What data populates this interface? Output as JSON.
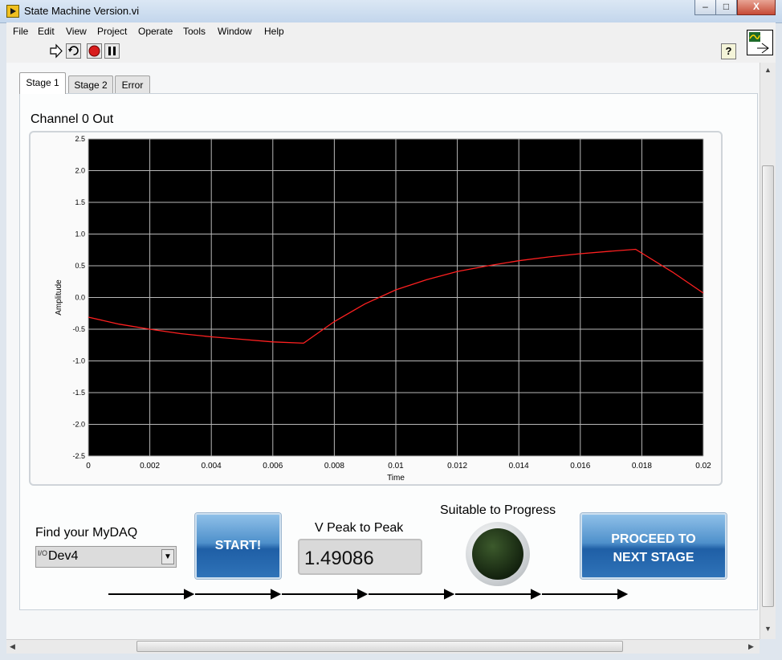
{
  "window": {
    "title": "State Machine Version.vi",
    "minimize": "–",
    "maximize": "□",
    "close": "X"
  },
  "menu": [
    "File",
    "Edit",
    "View",
    "Project",
    "Operate",
    "Tools",
    "Window",
    "Help"
  ],
  "toolbar": {
    "icons": [
      "run-arrow-icon",
      "run-continuously-icon",
      "abort-icon",
      "pause-icon"
    ],
    "help": "?"
  },
  "tabs": [
    {
      "label": "Stage 1",
      "active": true
    },
    {
      "label": "Stage 2",
      "active": false
    },
    {
      "label": "Error",
      "active": false
    }
  ],
  "graph": {
    "label": "Channel 0 Out"
  },
  "chart_data": {
    "type": "line",
    "xlabel": "Time",
    "ylabel": "Amplitude",
    "xlim": [
      0,
      0.02
    ],
    "ylim": [
      -2.5,
      2.5
    ],
    "xticks": [
      "0",
      "0.002",
      "0.004",
      "0.006",
      "0.008",
      "0.01",
      "0.012",
      "0.014",
      "0.016",
      "0.018",
      "0.02"
    ],
    "yticks": [
      "2.5",
      "2.0",
      "1.5",
      "1.0",
      "0.5",
      "0.0",
      "-0.5",
      "-1.0",
      "-1.5",
      "-2.0",
      "-2.5"
    ],
    "grid": true,
    "background": "#000000",
    "series": [
      {
        "color": "#ff2020",
        "x": [
          0,
          0.001,
          0.002,
          0.003,
          0.004,
          0.005,
          0.006,
          0.007,
          0.0075,
          0.008,
          0.009,
          0.01,
          0.011,
          0.012,
          0.013,
          0.014,
          0.015,
          0.016,
          0.017,
          0.0178,
          0.019,
          0.02
        ],
        "y": [
          -0.31,
          -0.42,
          -0.5,
          -0.57,
          -0.62,
          -0.66,
          -0.7,
          -0.72,
          -0.55,
          -0.38,
          -0.1,
          0.12,
          0.28,
          0.41,
          0.5,
          0.58,
          0.64,
          0.69,
          0.73,
          0.76,
          0.4,
          0.07
        ]
      }
    ]
  },
  "controls": {
    "find_label": "Find your MyDAQ",
    "device_io": "I/O",
    "device_value": "Dev4",
    "start_label": "START!",
    "vpp_label": "V Peak to Peak",
    "vpp_value": "1.49086",
    "suitable_label": "Suitable to Progress",
    "proceed_label_line1": "PROCEED TO",
    "proceed_label_line2": "NEXT STAGE"
  },
  "colors": {
    "led_off": "#1e3216",
    "button": "#2f73b8"
  }
}
